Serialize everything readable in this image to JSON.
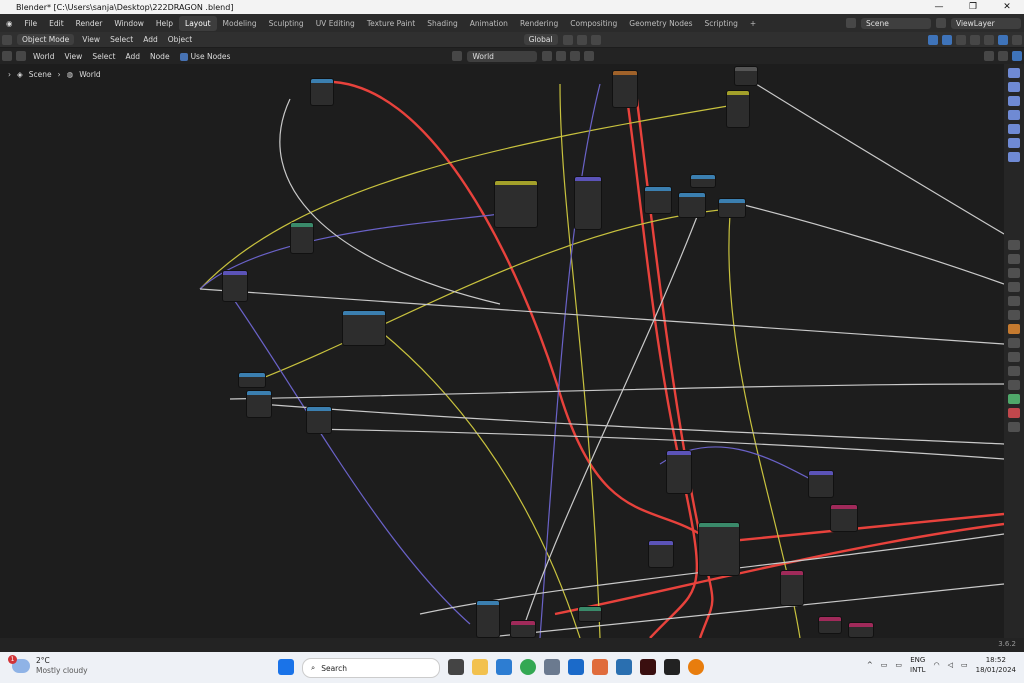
{
  "window": {
    "title": "Blender* [C:\\Users\\sanja\\Desktop\\222DRAGON .blend]"
  },
  "menus": [
    "File",
    "Edit",
    "Render",
    "Window",
    "Help"
  ],
  "workspaces": [
    {
      "label": "Layout",
      "active": true
    },
    {
      "label": "Modeling"
    },
    {
      "label": "Sculpting"
    },
    {
      "label": "UV Editing"
    },
    {
      "label": "Texture Paint"
    },
    {
      "label": "Shading"
    },
    {
      "label": "Animation"
    },
    {
      "label": "Rendering"
    },
    {
      "label": "Compositing"
    },
    {
      "label": "Geometry Nodes"
    },
    {
      "label": "Scripting"
    },
    {
      "label": "+"
    }
  ],
  "scene": {
    "name": "Scene",
    "view_layer": "ViewLayer"
  },
  "viewport_header": {
    "mode": "Object Mode",
    "menus": [
      "View",
      "Select",
      "Add",
      "Object"
    ],
    "transform": "Global"
  },
  "node_header": {
    "context": "World",
    "menus": [
      "View",
      "Select",
      "Add",
      "Node"
    ],
    "use_nodes_label": "Use Nodes",
    "world_name": "World"
  },
  "breadcrumb": [
    "Scene",
    "World"
  ],
  "status": {
    "version": "3.6.2"
  },
  "taskbar": {
    "weather_badge": "1",
    "temperature": "2°C",
    "condition": "Mostly cloudy",
    "search_placeholder": "Search",
    "lang_top": "ENG",
    "lang_bottom": "INTL",
    "time": "18:52",
    "date": "18/01/2024"
  },
  "colors": {
    "accent": "#4772b3",
    "wire_red": "#e8423c",
    "wire_yellow": "#c8c23e",
    "wire_purple": "#6a62c8",
    "wire_white": "#c9c9c9"
  }
}
